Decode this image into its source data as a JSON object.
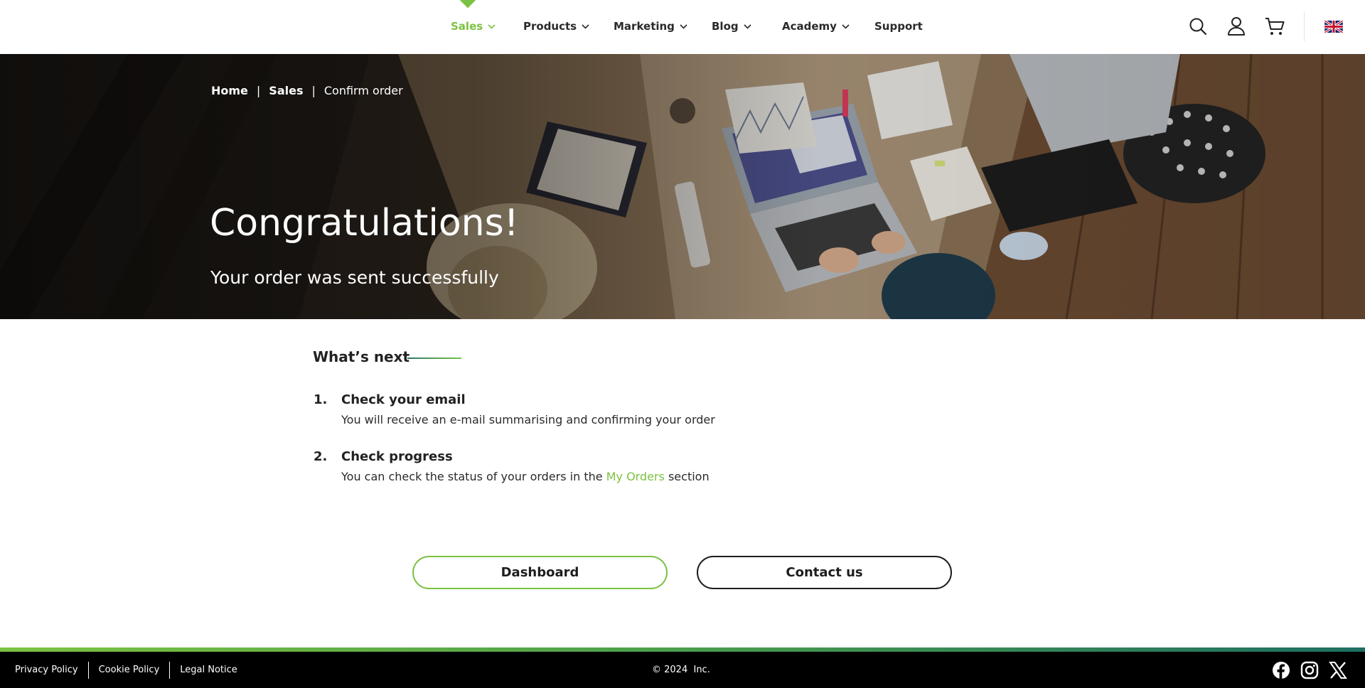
{
  "header": {
    "nav": [
      {
        "label": "Sales",
        "active": true
      },
      {
        "label": "Products",
        "active": false
      },
      {
        "label": "Marketing",
        "active": false
      },
      {
        "label": "Blog",
        "active": false
      },
      {
        "label": "Academy",
        "active": false
      },
      {
        "label": "Support",
        "active": false
      }
    ],
    "icons": [
      "search-icon",
      "user-icon",
      "cart-icon",
      "uk-flag-icon"
    ]
  },
  "hero": {
    "breadcrumb": [
      "Home",
      "Sales",
      "Confirm order"
    ],
    "breadcrumb_separator": "|",
    "title": "Congratulations!",
    "subtitle": "Your order was sent successfully"
  },
  "next": {
    "heading": "What’s next",
    "steps": [
      {
        "number": "1.",
        "title": "Check your email",
        "desc": "You will receive an e-mail summarising and confirming your order"
      },
      {
        "number": "2.",
        "title": "Check progress",
        "desc_before": "You can check the status of your orders in the",
        "link": "My Orders",
        "desc_after": "section"
      }
    ]
  },
  "buttons": {
    "dashboard": "Dashboard",
    "contact": "Contact us"
  },
  "footer": {
    "links": [
      "Privacy Policy",
      "Cookie Policy",
      "Legal Notice"
    ],
    "copyright": "© 2024",
    "company": "Inc.",
    "social_icons": [
      "facebook-icon",
      "instagram-icon",
      "x-icon"
    ]
  },
  "colors": {
    "accent": "#7cc242",
    "footer_bg": "#000000",
    "text": "#1d1d1d"
  }
}
